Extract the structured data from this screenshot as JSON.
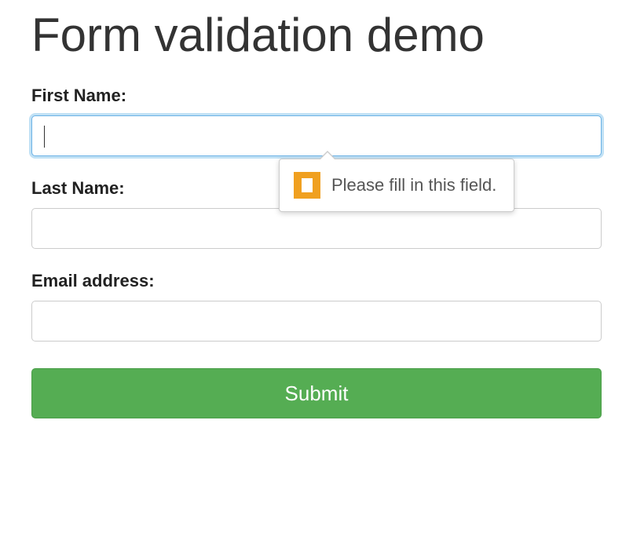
{
  "page": {
    "title": "Form validation demo"
  },
  "form": {
    "fields": [
      {
        "label": "First Name:",
        "value": "",
        "focused": true
      },
      {
        "label": "Last Name:",
        "value": "",
        "focused": false
      },
      {
        "label": "Email address:",
        "value": "",
        "focused": false
      }
    ],
    "submit_label": "Submit"
  },
  "validation": {
    "message": "Please fill in this field.",
    "icon": "warning-icon"
  }
}
